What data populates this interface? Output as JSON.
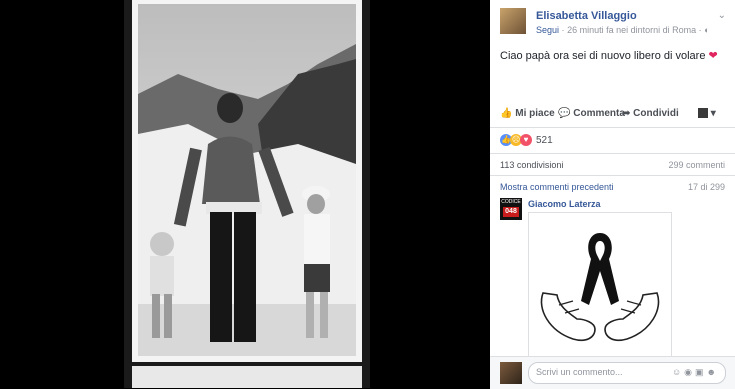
{
  "post": {
    "author": "Elisabetta Villaggio",
    "follow": "Segui",
    "meta_sep": "·",
    "time_location": "26 minuti fa nei dintorni di Roma",
    "meta_tail": "·",
    "text": "Ciao papà ora sei di nuovo libero di volare",
    "heart": "❤"
  },
  "actions": {
    "like": "Mi piace",
    "comment": "Commenta",
    "share": "Condividi"
  },
  "reactions": {
    "count": "521"
  },
  "stats": {
    "shares": "113 condivisioni",
    "comments": "299 commenti"
  },
  "comments": {
    "previous": "Mostra commenti precedenti",
    "pager": "17 di 299",
    "first": {
      "author": "Giacomo Laterza",
      "avatar_top": "CODICE",
      "avatar_code": "048"
    }
  },
  "composer": {
    "placeholder": "Scrivi un commento..."
  },
  "colors": {
    "link": "#365899",
    "heart": "#e0245e"
  }
}
